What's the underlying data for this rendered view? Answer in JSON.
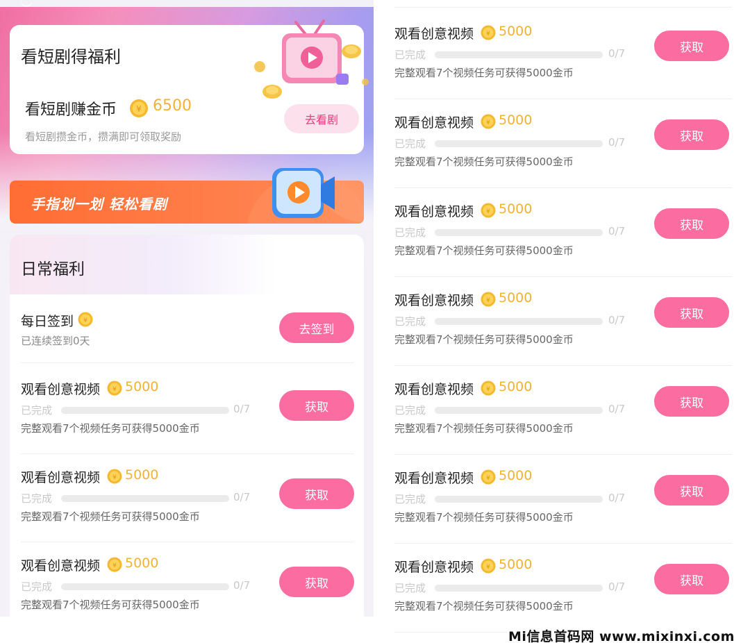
{
  "drama_card": {
    "title": "看短剧得福利",
    "earn_title": "看短剧赚金币",
    "earn_amount": "6500",
    "earn_desc": "看短剧攒金币，攒满即可领取奖励",
    "button_label": "去看剧"
  },
  "banner": {
    "text": "手指划一划 轻松看剧"
  },
  "daily": {
    "title": "日常福利",
    "checkin": {
      "title": "每日签到",
      "subtitle": "已连续签到0天",
      "button_label": "去签到"
    }
  },
  "left_tasks": [
    {
      "title": "观看创意视频",
      "amount": "5000",
      "status": "已完成",
      "count": "0/7",
      "progress": 0,
      "desc": "完整观看7个视频任务可获得5000金币",
      "button": "获取"
    },
    {
      "title": "观看创意视频",
      "amount": "5000",
      "status": "已完成",
      "count": "0/7",
      "progress": 0,
      "desc": "完整观看7个视频任务可获得5000金币",
      "button": "获取"
    },
    {
      "title": "观看创意视频",
      "amount": "5000",
      "status": "已完成",
      "count": "0/7",
      "progress": 0,
      "desc": "完整观看7个视频任务可获得5000金币",
      "button": "获取"
    }
  ],
  "right_tasks": [
    {
      "title": "观看创意视频",
      "amount": "5000",
      "status": "已完成",
      "count": "0/7",
      "progress": 0,
      "desc": "完整观看7个视频任务可获得5000金币",
      "button": "获取"
    },
    {
      "title": "观看创意视频",
      "amount": "5000",
      "status": "已完成",
      "count": "0/7",
      "progress": 0,
      "desc": "完整观看7个视频任务可获得5000金币",
      "button": "获取"
    },
    {
      "title": "观看创意视频",
      "amount": "5000",
      "status": "已完成",
      "count": "0/7",
      "progress": 0,
      "desc": "完整观看7个视频任务可获得5000金币",
      "button": "获取"
    },
    {
      "title": "观看创意视频",
      "amount": "5000",
      "status": "已完成",
      "count": "0/7",
      "progress": 0,
      "desc": "完整观看7个视频任务可获得5000金币",
      "button": "获取"
    },
    {
      "title": "观看创意视频",
      "amount": "5000",
      "status": "已完成",
      "count": "0/7",
      "progress": 0,
      "desc": "完整观看7个视频任务可获得5000金币",
      "button": "获取"
    },
    {
      "title": "观看创意视频",
      "amount": "5000",
      "status": "已完成",
      "count": "0/7",
      "progress": 0,
      "desc": "完整观看7个视频任务可获得5000金币",
      "button": "获取"
    },
    {
      "title": "观看创意视频",
      "amount": "5000",
      "status": "已完成",
      "count": "0/7",
      "progress": 0,
      "desc": "完整观看7个视频任务可获得5000金币",
      "button": "获取"
    }
  ],
  "watermark": "Mi信息首码网 www.mixinxi.com",
  "colors": {
    "accent_pink": "#fb6da0",
    "coin_gold": "#f2b233",
    "banner_orange": "#ff6d33"
  },
  "icons": {
    "coin": "gold-coin-icon",
    "tv": "tv-play-icon",
    "play": "video-play-icon"
  }
}
